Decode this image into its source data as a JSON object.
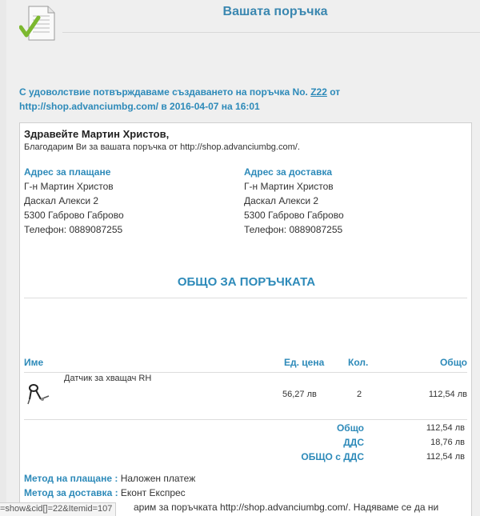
{
  "header": {
    "title": "Вашата поръчка",
    "icon": "document-check-icon"
  },
  "confirm": {
    "prefix": "С удоволствие потвърждаваме създаването на поръчка No. ",
    "order_no": "Z22",
    "suffix": " от http://shop.advanciumbg.com/ в 2016-04-07 на 16:01"
  },
  "greeting": {
    "hello": "Здравейте Мартин Христов,",
    "thanks": "Благодарим Ви за вашата поръчка от http://shop.advanciumbg.com/."
  },
  "billing": {
    "heading": "Адрес за плащане",
    "lines": [
      "Г-н Мартин Христов",
      "Даскал Алекси 2",
      "5300 Габрово Габрово",
      "Телефон: 0889087255"
    ]
  },
  "shipping": {
    "heading": "Адрес за доставка",
    "lines": [
      "Г-н Мартин Христов",
      "Даскал Алекси 2",
      "5300 Габрово Габрово",
      "Телефон: 0889087255"
    ]
  },
  "totals_title": "ОБЩО ЗА ПОРЪЧКАТА",
  "table": {
    "headers": {
      "name": "Име",
      "unit_price": "Ед. цена",
      "qty": "Кол.",
      "total": "Общо"
    },
    "rows": [
      {
        "name": "Датчик за хващач RH",
        "unit_price": "56,27 лв",
        "qty": "2",
        "total": "112,54 лв",
        "icon": "gripper-sensor-icon"
      }
    ]
  },
  "summary": {
    "total_label": "Общо",
    "total_value": "112,54 лв",
    "vat_label": "ДДС",
    "vat_value": "18,76 лв",
    "grand_label": "ОБЩО с ДДС",
    "grand_value": "112,54 лв"
  },
  "payment": {
    "label": "Метод на плащане :",
    "value": "Наложен платеж"
  },
  "delivery": {
    "label": "Метод за доставка :",
    "value": "Еконт Експрес"
  },
  "footer_text": "арим за поръчката http://shop.advanciumbg.com/. Надяваме се да ни",
  "statusbar": "=show&cid[]=22&Itemid=107"
}
